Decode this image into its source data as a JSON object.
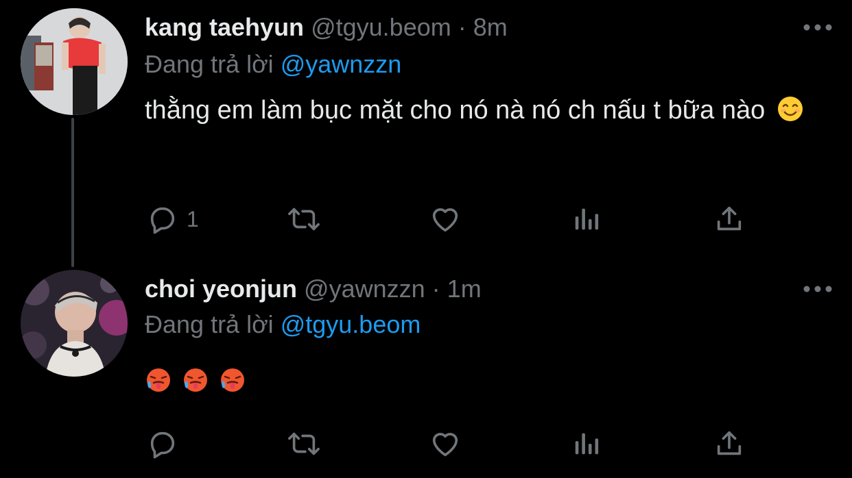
{
  "colors": {
    "background": "#000000",
    "text_primary": "#e7e9ea",
    "text_secondary": "#71767b",
    "link": "#1d9bf0",
    "thread_line": "#3d4145"
  },
  "tweets": [
    {
      "display_name": "kang taehyun",
      "handle": "@tgyu.beom",
      "separator": "·",
      "time": "8m",
      "reply_prefix": "Đang trả lời",
      "reply_mention": "@yawnzzn",
      "text": "thằng em làm bục mặt cho nó nà nó ch nấu t bữa nào",
      "emojis": [
        "smiling-face-with-smiling-eyes"
      ],
      "reply_count": "1",
      "icons": [
        "avatar",
        "more-icon",
        "reply-icon",
        "retweet-icon",
        "like-icon",
        "views-icon",
        "share-icon"
      ]
    },
    {
      "display_name": "choi yeonjun",
      "handle": "@yawnzzn",
      "separator": "·",
      "time": "1m",
      "reply_prefix": "Đang trả lời",
      "reply_mention": "@tgyu.beom",
      "text": "",
      "emojis": [
        "hot-face",
        "hot-face",
        "hot-face"
      ],
      "reply_count": "",
      "icons": [
        "avatar",
        "more-icon",
        "reply-icon",
        "retweet-icon",
        "like-icon",
        "views-icon",
        "share-icon"
      ]
    }
  ]
}
